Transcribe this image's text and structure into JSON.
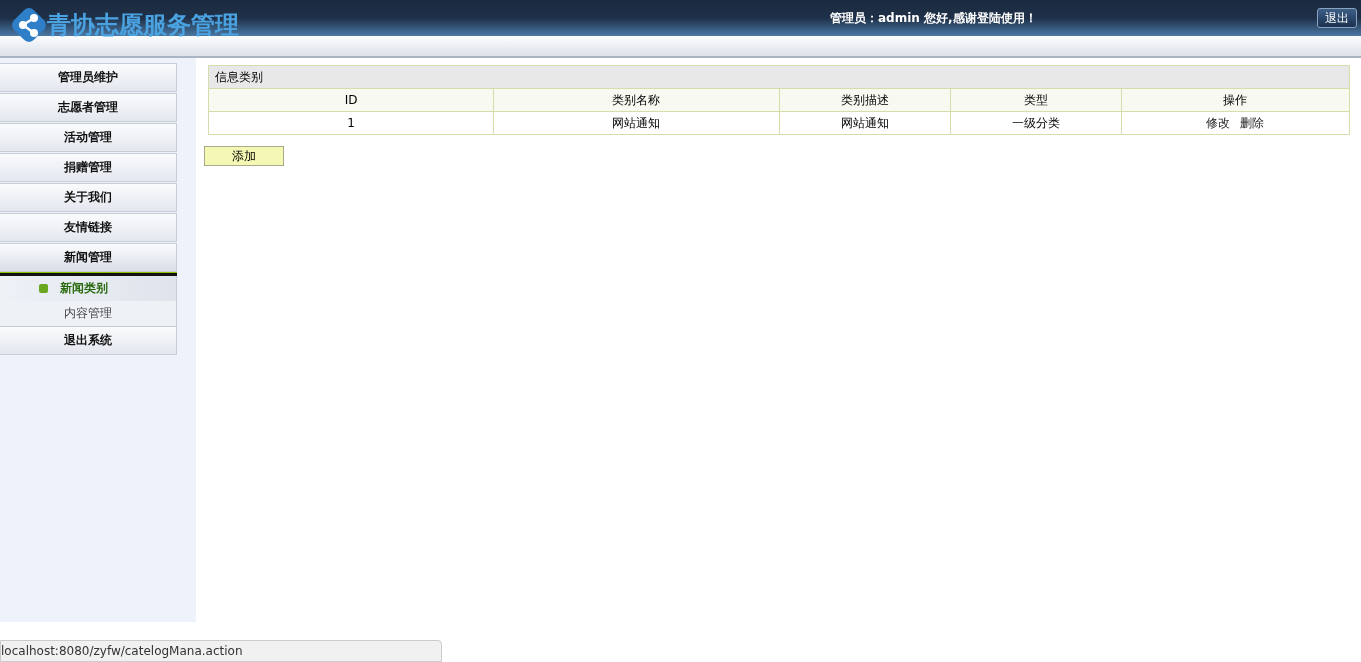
{
  "header": {
    "title": "青协志愿服务管理",
    "greeting": "管理员：admin 您好,感谢登陆使用！",
    "logout": "退出"
  },
  "sidebar": {
    "items": [
      {
        "label": "管理员维护",
        "expanded": false
      },
      {
        "label": "志愿者管理",
        "expanded": false
      },
      {
        "label": "活动管理",
        "expanded": false
      },
      {
        "label": "捐赠管理",
        "expanded": false
      },
      {
        "label": "关于我们",
        "expanded": false
      },
      {
        "label": "友情链接",
        "expanded": false
      },
      {
        "label": "新闻管理",
        "expanded": true,
        "children": [
          {
            "label": "新闻类别",
            "selected": true
          },
          {
            "label": "内容管理",
            "selected": false
          }
        ]
      },
      {
        "label": "退出系统",
        "expanded": false
      }
    ]
  },
  "table": {
    "title": "信息类别",
    "columns": [
      "ID",
      "类别名称",
      "类别描述",
      "类型",
      "操作"
    ],
    "rows": [
      {
        "cells": [
          "1",
          "网站通知",
          "网站通知",
          "一级分类"
        ],
        "actions": [
          "修改",
          "删除"
        ]
      }
    ]
  },
  "add_button": "添加",
  "status_bar": "localhost:8080/zyfw/catelogMana.action"
}
